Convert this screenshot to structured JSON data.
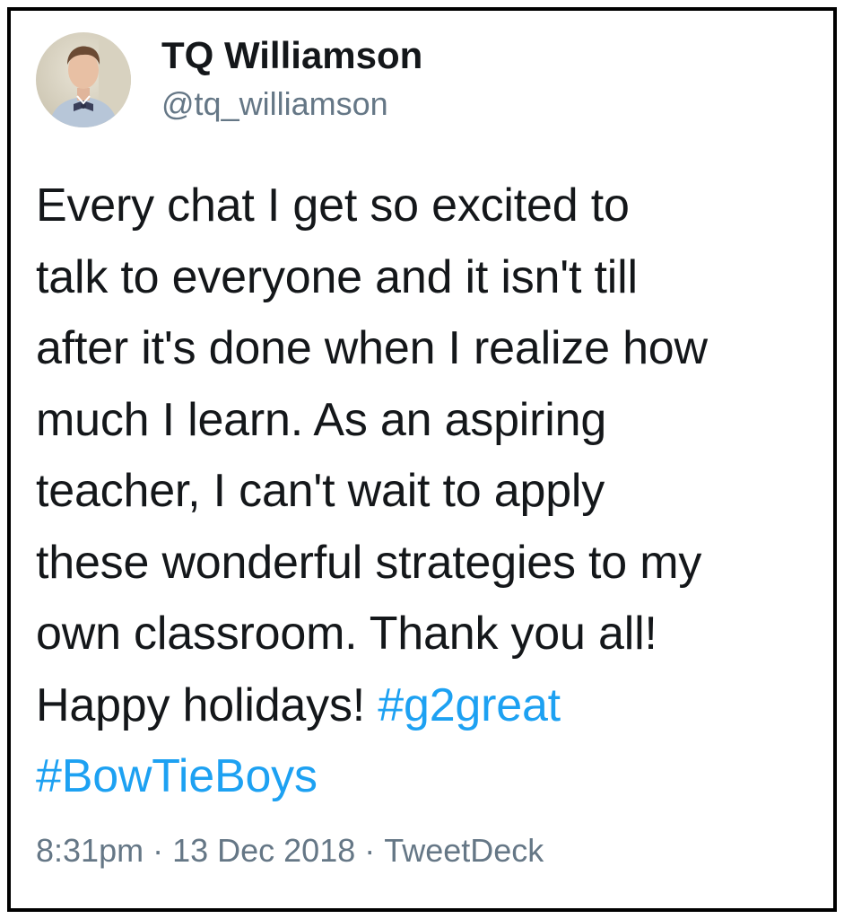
{
  "user": {
    "display_name": "TQ Williamson",
    "handle": "@tq_williamson"
  },
  "tweet": {
    "lines": [
      "Every chat I get so excited to",
      "talk to everyone and it isn't till",
      "after it's done when I realize how",
      "much I learn. As an aspiring",
      "teacher, I can't wait to apply",
      "these wonderful strategies to my",
      "own classroom. Thank you all!",
      "Happy holidays! "
    ],
    "hashtags": [
      "#g2great",
      "#BowTieBoys"
    ]
  },
  "meta": {
    "time": "8:31pm",
    "separator": "·",
    "date": "13 Dec 2018",
    "source": "TweetDeck"
  },
  "colors": {
    "text": "#14171a",
    "secondary": "#657786",
    "link": "#1da1f2",
    "border": "#000000"
  }
}
